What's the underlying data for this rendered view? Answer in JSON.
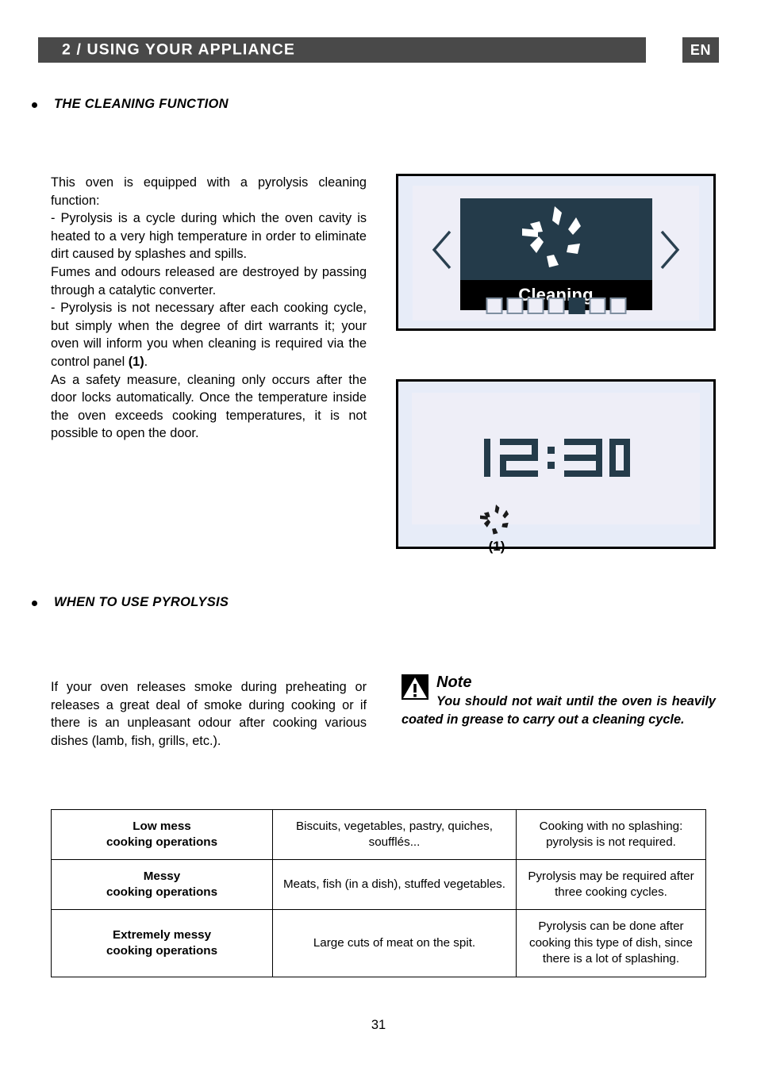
{
  "header": {
    "title": "2 / USING YOUR APPLIANCE",
    "language_badge": "EN"
  },
  "sections": [
    {
      "id": "cleaning_function",
      "heading": "THE CLEANING FUNCTION"
    },
    {
      "id": "when_to_use",
      "heading": "WHEN TO USE PYROLYSIS"
    }
  ],
  "body": {
    "cleaning_function_paragraphs": [
      "This oven is equipped with a pyrolysis cleaning function:",
      "- Pyrolysis is a cycle during which the oven cavity is heated to a very high temperature in order to eliminate dirt caused by splashes and spills.",
      "Fumes and odours released are destroyed by passing through a catalytic converter.",
      "- Pyrolysis is not necessary after each cooking cycle, but simply when the degree of dirt warrants it; your oven will inform you when cleaning is required via the control panel ",
      "As a safety measure, cleaning only occurs after the door locks automatically. Once the temperature inside the oven exceeds cooking temperatures, it is not possible to open the door."
    ],
    "control_panel_ref": "(1)",
    "control_panel_ref_suffix": ".",
    "when_to_use_paragraph": "If your oven releases smoke during preheating or releases a great deal of smoke during cooking or if there is an unpleasant odour after cooking various dishes (lamb, fish, grills, etc.)."
  },
  "figure_display": {
    "name": "oven-display-cleaning-mode",
    "screen_label": "Cleaning",
    "icon_name": "pyrolysis-swirl-icon",
    "nav_left_icon": "chevron-left-icon",
    "nav_right_icon": "chevron-right-icon",
    "step_count": 7,
    "active_step_index": 5,
    "screen_bg_color": "#243b4a",
    "label_bg_color": "#000000"
  },
  "figure_clock": {
    "name": "oven-display-clock",
    "time": "12:30",
    "time_digits": [
      "1",
      "2",
      "3",
      "0"
    ],
    "icon_name": "pyrolysis-swirl-icon",
    "caption": "(1)",
    "digit_color": "#243b4a"
  },
  "note": {
    "icon_name": "warning-triangle-icon",
    "title": "Note",
    "text": "You should not wait until the oven is heavily coated in grease to carry out a cleaning cycle."
  },
  "table": {
    "rows": [
      {
        "category": "Low mess\ncooking operations",
        "examples": "Biscuits, vegetables, pastry, quiches, soufflés...",
        "recommendation": "Cooking with no splashing: pyrolysis is not required."
      },
      {
        "category": "Messy\ncooking operations",
        "examples": "Meats, fish (in a dish), stuffed vegetables.",
        "recommendation": "Pyrolysis may be required after three cooking cycles."
      },
      {
        "category": "Extremely messy\ncooking operations",
        "examples": "Large cuts of meat on the spit.",
        "recommendation": "Pyrolysis can be done after cooking this type of dish, since there is a lot of splashing."
      }
    ]
  },
  "footer": {
    "page_number": "31"
  }
}
